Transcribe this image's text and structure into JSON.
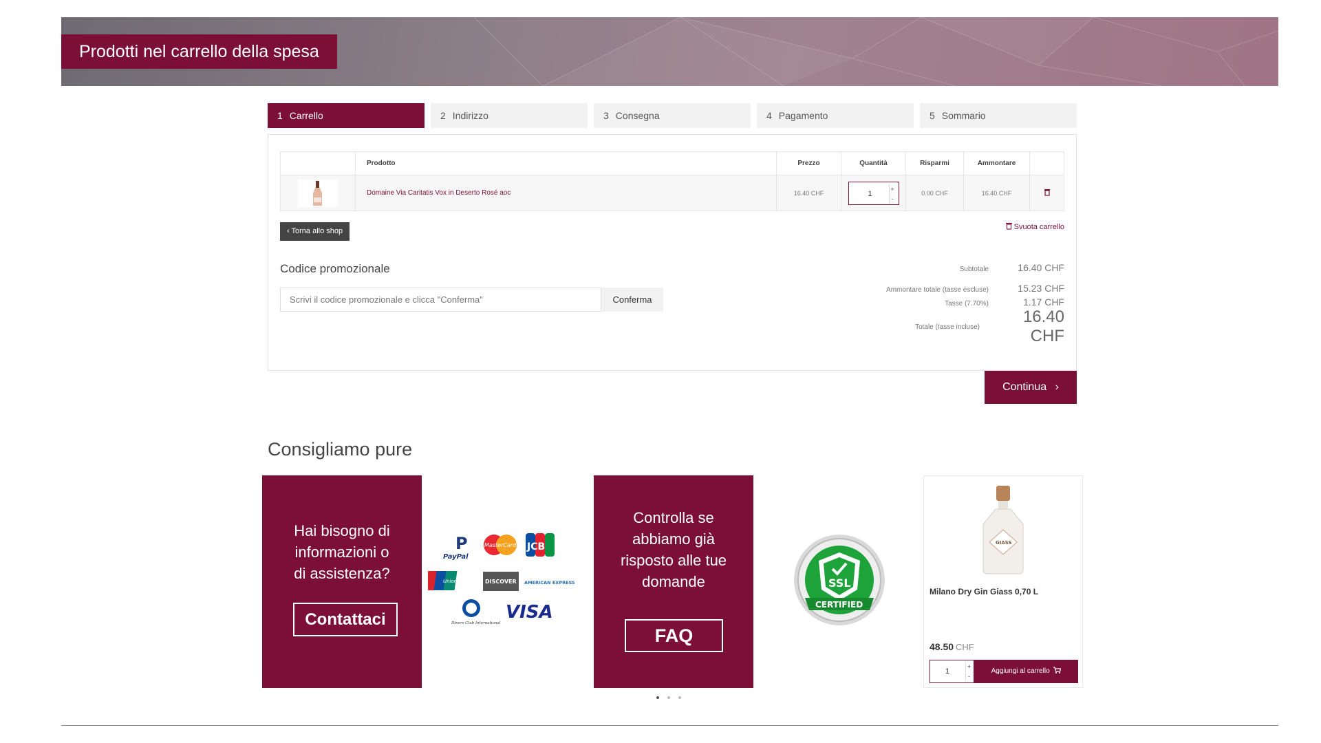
{
  "banner": {
    "title": "Prodotti nel carrello della spesa"
  },
  "steps": [
    {
      "num": "1",
      "label": "Carrello"
    },
    {
      "num": "2",
      "label": "Indirizzo"
    },
    {
      "num": "3",
      "label": "Consegna"
    },
    {
      "num": "4",
      "label": "Pagamento"
    },
    {
      "num": "5",
      "label": "Sommario"
    }
  ],
  "cart": {
    "headers": {
      "product": "Prodotto",
      "price": "Prezzo",
      "quantity": "Quantità",
      "savings": "Risparmi",
      "amount": "Ammontare"
    },
    "items": [
      {
        "name": "Domaine Via Caritatis Vox in Deserto Rosé aoc",
        "price": "16.40 CHF",
        "quantity": "1",
        "savings": "0.00 CHF",
        "amount": "16.40 CHF"
      }
    ],
    "back_label": "Torna allo shop",
    "empty_label": "Svuota carrello"
  },
  "promo": {
    "title": "Codice promozionale",
    "placeholder": "Scrivi il codice promozionale e clicca \"Conferma\"",
    "button": "Conferma"
  },
  "totals": {
    "subtotal_label": "Subtotale",
    "subtotal": "16.40 CHF",
    "net_label": "Ammontare totale (tasse escluse)",
    "net": "15.23 CHF",
    "tax_label": "Tasse (7.70%)",
    "tax": "1.17 CHF",
    "total_label": "Totale (tasse incluse)",
    "total": "16.40 CHF"
  },
  "continue_label": "Continua",
  "recommend": {
    "title": "Consigliamo pure",
    "help_text": "Hai bisogno di informazioni o di assistenza?",
    "help_button": "Contattaci",
    "faq_text": "Controlla se abbiamo già risposto alle tue domande",
    "faq_button": "FAQ",
    "payment_logos": [
      "PayPal",
      "MasterCard",
      "JCB",
      "UnionPay",
      "DISCOVER",
      "AMERICAN EXPRESS",
      "Diners Club International",
      "VISA"
    ],
    "ssl_badge": {
      "text": "SSL",
      "ribbon": "CERTIFIED"
    },
    "product": {
      "name": "Milano Dry Gin Giass 0,70 L",
      "price": "48.50",
      "currency": "CHF",
      "quantity": "1",
      "add_label": "Aggiungi al carrello",
      "bottle_label": "GIASS"
    },
    "carousel_pages": 3,
    "carousel_active": 1
  },
  "colors": {
    "accent": "#7b0f35"
  }
}
